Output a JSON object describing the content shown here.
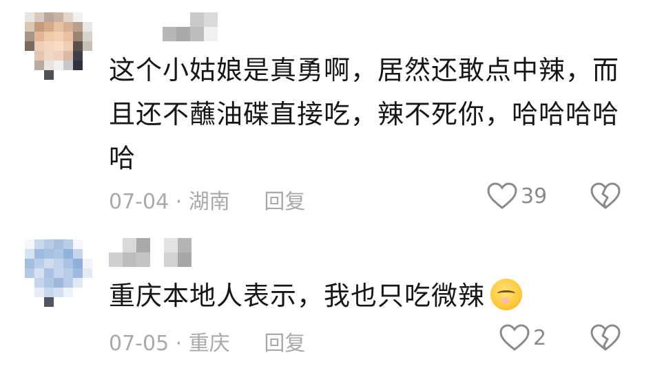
{
  "comments": [
    {
      "text": "这个小姑娘是真勇啊，居然还敢点中辣，而且还不蘸油碟直接吃，辣不死你，哈哈哈哈哈",
      "date": "07-04",
      "location": "湖南",
      "reply_label": "回复",
      "likes": "39",
      "avatar_icon": "pixelated-avatar",
      "colors": {
        "text": "#161616",
        "meta": "#a9a9a9"
      }
    },
    {
      "text": "重庆本地人表示，我也只吃微辣",
      "emoji": "shushing-face-emoji",
      "date": "07-05",
      "location": "重庆",
      "reply_label": "回复",
      "likes": "2",
      "avatar_icon": "pixelated-avatar"
    }
  ],
  "icons": {
    "like": "heart-outline-icon",
    "dislike": "broken-heart-icon"
  },
  "separator": " · "
}
